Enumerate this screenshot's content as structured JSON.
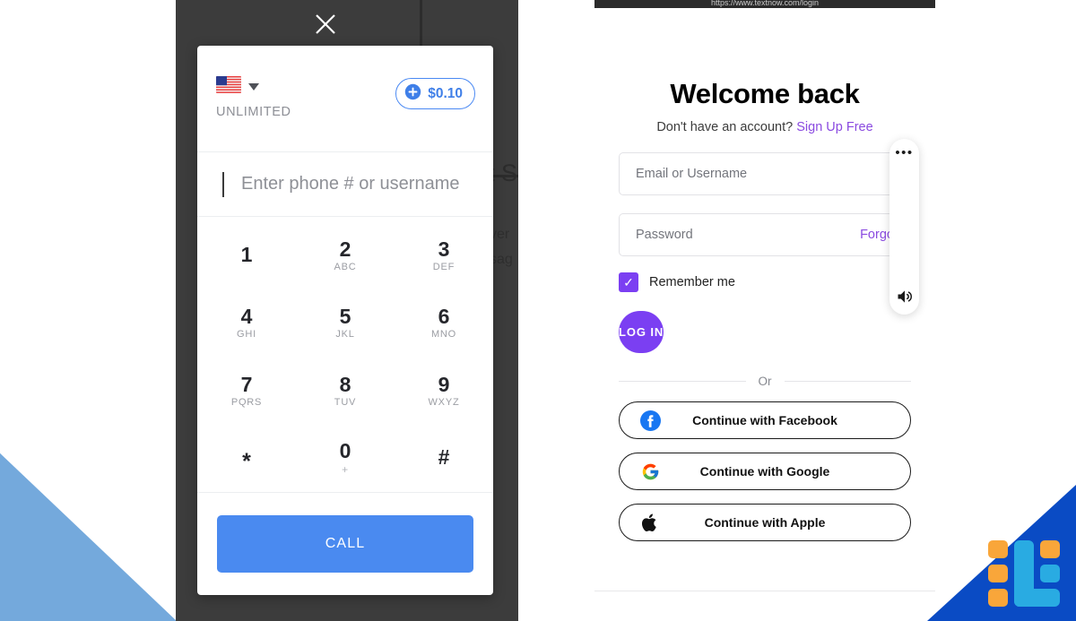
{
  "browser": {
    "url": "https://www.textnow.com/login"
  },
  "dialer": {
    "country_flag": "us-flag-icon",
    "country_dropdown": "chevron-down-icon",
    "plan_label": "UNLIMITED",
    "credit": {
      "icon": "plus-circle-icon",
      "amount": "$0.10"
    },
    "input": {
      "placeholder": "Enter phone # or username",
      "value": ""
    },
    "keys": [
      {
        "digit": "1",
        "letters": ""
      },
      {
        "digit": "2",
        "letters": "ABC"
      },
      {
        "digit": "3",
        "letters": "DEF"
      },
      {
        "digit": "4",
        "letters": "GHI"
      },
      {
        "digit": "5",
        "letters": "JKL"
      },
      {
        "digit": "6",
        "letters": "MNO"
      },
      {
        "digit": "7",
        "letters": "PQRS"
      },
      {
        "digit": "8",
        "letters": "TUV"
      },
      {
        "digit": "9",
        "letters": "WXYZ"
      },
      {
        "digit": "*",
        "letters": ""
      },
      {
        "digit": "0",
        "letters": "+"
      },
      {
        "digit": "#",
        "letters": ""
      }
    ],
    "call_button": "CALL",
    "close_icon": "close-icon"
  },
  "background_page": {
    "heading_fragment": "t S",
    "body_fragment_1": "ver",
    "body_fragment_2": "sag"
  },
  "login": {
    "title": "Welcome back",
    "signup_prompt": "Don't have an account?",
    "signup_link": "Sign Up Free",
    "email": {
      "placeholder": "Email or Username",
      "value": ""
    },
    "password": {
      "placeholder": "Password",
      "value": "",
      "forgot_link": "Forgot"
    },
    "remember": {
      "label": "Remember me",
      "checked": true,
      "check_glyph": "✓"
    },
    "submit": "LOG IN",
    "divider": "Or",
    "social": [
      {
        "label": "Continue with Facebook",
        "icon": "facebook-icon"
      },
      {
        "label": "Continue with Google",
        "icon": "google-icon"
      },
      {
        "label": "Continue with Apple",
        "icon": "apple-icon"
      }
    ]
  },
  "floating_panel": {
    "more_icon": "ellipsis-icon",
    "more_glyph": "•••",
    "speaker_icon": "speaker-icon"
  },
  "decor": {
    "logo_name": "site-logo",
    "triangle_left": "decorative-blue-triangle",
    "corner_right": "decorative-blue-corner"
  },
  "colors": {
    "dialer_blue": "#4a8af0",
    "credit_blue": "#3f7fe8",
    "login_purple": "#7b3ff2",
    "link_purple": "#8a4ae0",
    "brand_blue": "#0a4bc4",
    "logo_orange": "#f9a63a",
    "logo_cyan": "#29abe2",
    "deco_light_blue": "#74a9dc",
    "scrim": "#3c3c3c"
  }
}
